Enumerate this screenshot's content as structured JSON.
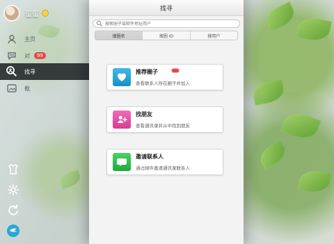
{
  "colors": {
    "accent_blue": "#2aa6d8",
    "pink": "#e84aa0",
    "green": "#2fbf4e",
    "badge_red": "#e54846"
  },
  "user": {
    "name": "蛋蛋"
  },
  "nav": {
    "items": [
      {
        "label": "主页",
        "icon": "profile-icon"
      },
      {
        "label": "对",
        "icon": "chat-icon",
        "badge": "99"
      },
      {
        "label": "找寻",
        "icon": "search-people-icon"
      },
      {
        "label": "截",
        "icon": "photo-icon"
      }
    ],
    "bottom_icons": [
      "shirt-icon",
      "gear-icon",
      "refresh-icon",
      "app-logo-icon"
    ]
  },
  "panel": {
    "title": "找寻",
    "search_placeholder": "搜索圈子或邮件地址用户",
    "segments": [
      "搜圈名",
      "搜圈 ID",
      "搜用户"
    ],
    "segment_active": 0,
    "cards": [
      {
        "title": "推荐圈子",
        "subtitle": "查看联系人所在圈子并加入",
        "icon": "heart-icon"
      },
      {
        "title": "找朋友",
        "subtitle": "查看通讯录并从中找到朋友",
        "icon": "add-friend-icon"
      },
      {
        "title": "邀请联系人",
        "subtitle": "通过邮件邀请通讯录联系人",
        "icon": "message-icon"
      }
    ]
  }
}
